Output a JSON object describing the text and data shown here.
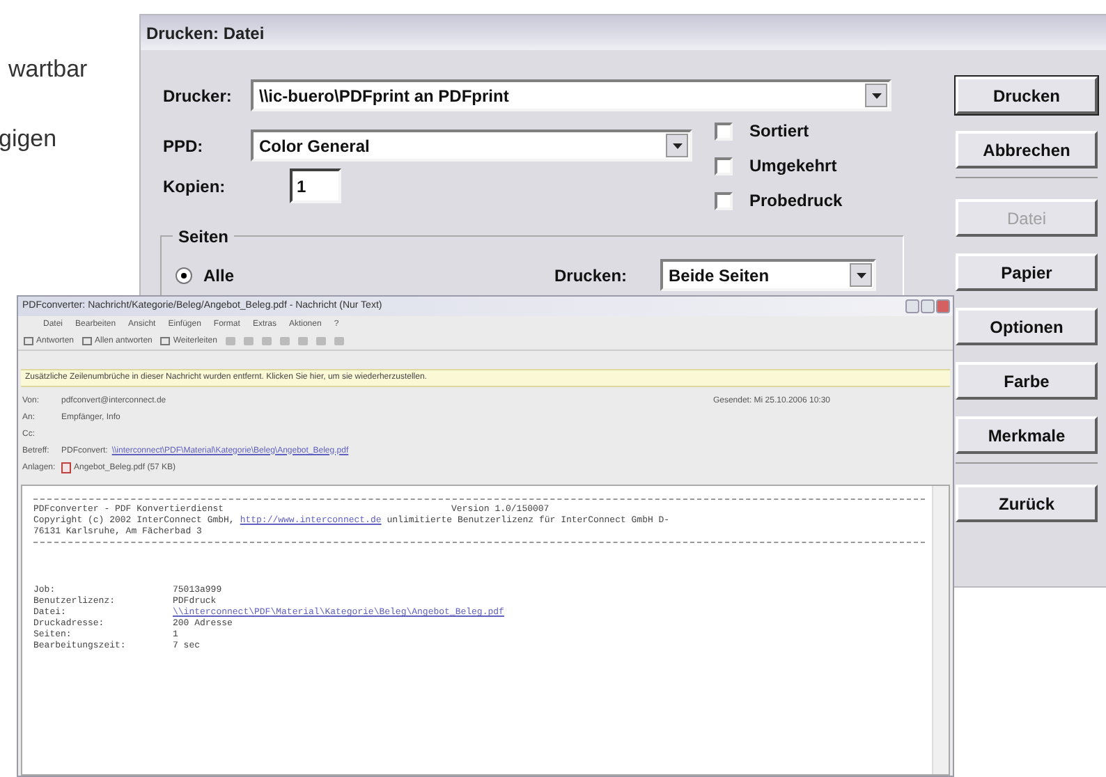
{
  "background_text": [
    {
      "text": "wartbar"
    },
    {
      "text": "gigen"
    }
  ],
  "print_dialog": {
    "title": "Drucken: Datei",
    "printer": {
      "label": "Drucker:",
      "value": "\\\\ic-buero\\PDFprint an PDFprint"
    },
    "ppd": {
      "label": "PPD:",
      "value": "Color General"
    },
    "copies": {
      "label": "Kopien:",
      "value": "1"
    },
    "options": [
      {
        "label": "Sortiert",
        "checked": false
      },
      {
        "label": "Umgekehrt",
        "checked": false
      },
      {
        "label": "Probedruck",
        "checked": false
      }
    ],
    "pages_group": {
      "title": "Seiten",
      "radios": [
        {
          "label": "Alle",
          "selected": true
        }
      ]
    },
    "duplex": {
      "label": "Drucken:",
      "value": "Beide Seiten"
    },
    "button_groups": [
      [
        {
          "label": "Drucken",
          "disabled": false,
          "default": true
        },
        {
          "label": "Abbrechen",
          "disabled": false,
          "default": false
        }
      ],
      [
        {
          "label": "Datei",
          "disabled": true,
          "default": false
        },
        {
          "label": "Papier",
          "disabled": false,
          "default": false
        },
        {
          "label": "Optionen",
          "disabled": false,
          "default": false
        },
        {
          "label": "Farbe",
          "disabled": false,
          "default": false
        },
        {
          "label": "Merkmale",
          "disabled": false,
          "default": false
        }
      ],
      [
        {
          "label": "Zurück",
          "disabled": false,
          "default": false
        }
      ]
    ]
  },
  "email_window": {
    "title": "PDFconverter: Nachricht/Kategorie/Beleg/Angebot_Beleg.pdf - Nachricht (Nur Text)",
    "menu": [
      "Datei",
      "Bearbeiten",
      "Ansicht",
      "Einfügen",
      "Format",
      "Extras",
      "Aktionen",
      "?"
    ],
    "toolbar": [
      "Antworten",
      "Allen antworten",
      "Weiterleiten"
    ],
    "info_bar": "Zusätzliche Zeilenumbrüche in dieser Nachricht wurden entfernt. Klicken Sie hier, um sie wiederherzustellen.",
    "sent": "Gesendet: Mi 25.10.2006 10:30",
    "headers": [
      {
        "label": "Von:",
        "value": "pdfconvert@interconnect.de",
        "kind": "text"
      },
      {
        "label": "An:",
        "value": "Empfänger, Info",
        "kind": "text"
      },
      {
        "label": "Cc:",
        "kind": "text"
      },
      {
        "label": "Betreff:",
        "prefix": "PDFconvert:",
        "value": "\\\\interconnect\\PDF\\Material\\Kategorie\\Beleg\\Angebot_Beleg.pdf",
        "kind": "link"
      },
      {
        "label": "Anlagen:",
        "value": "Angebot_Beleg.pdf (57 KB)",
        "kind": "attachment"
      }
    ],
    "body": {
      "product": "PDFconverter - PDF Konvertierdienst",
      "version": "Version 1.0/150007",
      "copyright": "Copyright (c) 2002 InterConnect GmbH,",
      "link": "http://www.interconnect.de",
      "license": "unlimitierte Benutzerlizenz für InterConnect GmbH D-",
      "address": "76131 Karlsruhe, Am Fächerbad 3",
      "fields": [
        {
          "label": "Job:",
          "value": "75013a999",
          "kind": "text"
        },
        {
          "label": "Benutzerlizenz:",
          "value": "PDFdruck",
          "kind": "text"
        },
        {
          "label": "Datei:",
          "value": "\\\\interconnect\\PDF\\Material\\Kategorie\\Beleg\\Angebot_Beleg.pdf",
          "kind": "link"
        },
        {
          "label": "Druckadresse:",
          "value": "200 Adresse",
          "kind": "text"
        },
        {
          "label": "Seiten:",
          "value": "1",
          "kind": "text"
        },
        {
          "label": "Bearbeitungszeit:",
          "value": "7 sec",
          "kind": "text"
        }
      ]
    }
  }
}
